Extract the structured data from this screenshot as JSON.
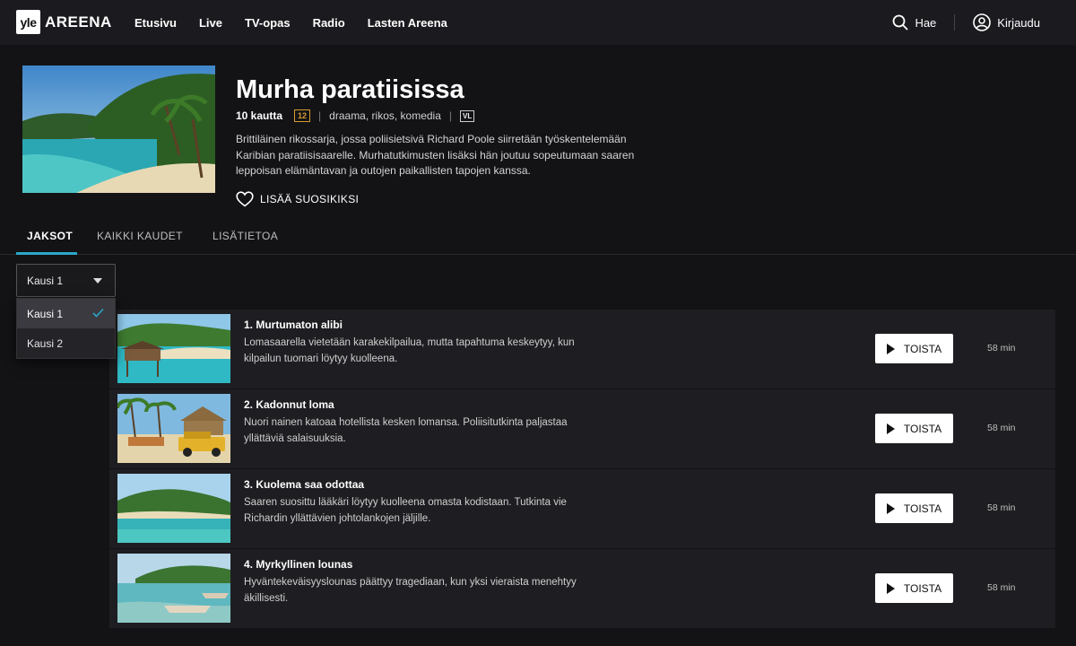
{
  "header": {
    "logo_mark": "yle",
    "logo_text": "AREENA",
    "nav": [
      "Etusivu",
      "Live",
      "TV-opas",
      "Radio",
      "Lasten Areena"
    ],
    "search_label": "Hae",
    "login_label": "Kirjaudu"
  },
  "series": {
    "title": "Murha paratiisissa",
    "episodes_count": "10 kautta",
    "age_rating": "12",
    "genres": "draama, rikos, komedia",
    "subtitle_badge": "VL",
    "description": "Brittiläinen rikossarja, jossa poliisietsivä Richard Poole siirretään työskentelemään Karibian paratiisisaarelle. Murhatutkimusten lisäksi hän joutuu sopeutumaan saaren leppoisan elämäntavan ja outojen paikallisten tapojen kanssa.",
    "favorite_label": "LISÄÄ SUOSIKIKSI"
  },
  "tabs": [
    "JAKSOT",
    "KAIKKI KAUDET",
    "LISÄTIETOA"
  ],
  "season_select": {
    "value": "Kausi 1",
    "options": [
      "Kausi 1",
      "Kausi 2"
    ]
  },
  "episodes": [
    {
      "title": "1. Murtumaton alibi",
      "desc": "Lomasaarella vietetään karakekilpailua, mutta tapahtuma keskeytyy, kun kilpailun tuomari löytyy kuolleena.",
      "play": "TOISTA",
      "duration": "58 min"
    },
    {
      "title": "2. Kadonnut loma",
      "desc": "Nuori nainen katoaa hotellista kesken lomansa. Poliisitutkinta paljastaa yllättäviä salaisuuksia.",
      "play": "TOISTA",
      "duration": "58 min"
    },
    {
      "title": "3. Kuolema saa odottaa",
      "desc": "Saaren suosittu lääkäri löytyy kuolleena omasta kodistaan. Tutkinta vie Richardin yllättävien johtolankojen jäljille.",
      "play": "TOISTA",
      "duration": "58 min"
    },
    {
      "title": "4. Myrkyllinen lounas",
      "desc": "Hyväntekeväisyyslounas päättyy tragediaan, kun yksi vieraista menehtyy äkillisesti.",
      "play": "TOISTA",
      "duration": "58 min"
    }
  ],
  "colors": {
    "background": "#131316",
    "accent": "#2aa6c8",
    "age_badge": "#d89a2b"
  }
}
